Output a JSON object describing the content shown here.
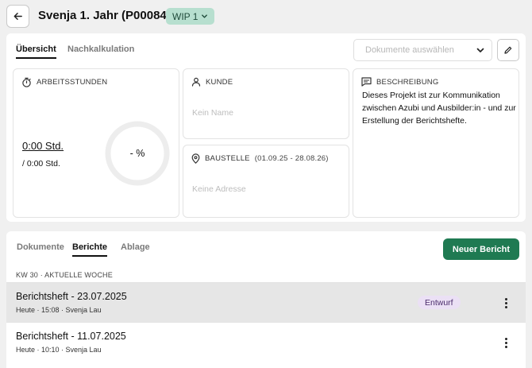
{
  "header": {
    "title": "Svenja 1. Jahr (P00084)",
    "status_badge": "WIP 1"
  },
  "overview": {
    "tabs": [
      {
        "label": "Übersicht",
        "active": true
      },
      {
        "label": "Nachkalkulation",
        "active": false
      }
    ],
    "documents_select": {
      "placeholder": "Dokumente auswählen"
    },
    "work_hours": {
      "heading": "ARBEITSSTUNDEN",
      "actual": "0:00 Std.",
      "planned": "/ 0:00 Std.",
      "percent_label": "- %",
      "progress": 0
    },
    "customer": {
      "heading": "KUNDE",
      "value": "Kein Name"
    },
    "site": {
      "heading": "BAUSTELLE",
      "date_range": "(01.09.25 - 28.08.26)",
      "value": "Keine Adresse"
    },
    "description": {
      "heading": "BESCHREIBUNG",
      "text": "Dieses Projekt ist zur Kommunikation zwischen Azubi und Ausbilder:in - und zur Erstellung der Berichtshefte."
    }
  },
  "reports": {
    "tabs": [
      {
        "label": "Dokumente",
        "active": false
      },
      {
        "label": "Berichte",
        "active": true
      },
      {
        "label": "Ablage",
        "active": false
      }
    ],
    "new_button": "Neuer Bericht",
    "week_label": "KW 30 · AKTUELLE WOCHE",
    "items": [
      {
        "title": "Berichtsheft - 23.07.2025",
        "meta": "Heute · 15:08 · Svenja Lau",
        "badge": "Entwurf",
        "highlighted": true
      },
      {
        "title": "Berichtsheft - 11.07.2025",
        "meta": "Heute · 10:10 · Svenja Lau",
        "badge": "",
        "highlighted": false
      }
    ]
  },
  "colors": {
    "accent": "#1f7a52",
    "wip_badge_bg": "#b7dfcf",
    "draft_badge_bg": "#ebe0f5",
    "highlight_row": "#e5e5e5",
    "background": "#f0f0f0"
  },
  "icons": [
    "arrow-left-icon",
    "chevron-down-icon",
    "pencil-icon",
    "stopwatch-icon",
    "person-icon",
    "map-pin-icon",
    "message-icon",
    "more-vertical-icon"
  ]
}
